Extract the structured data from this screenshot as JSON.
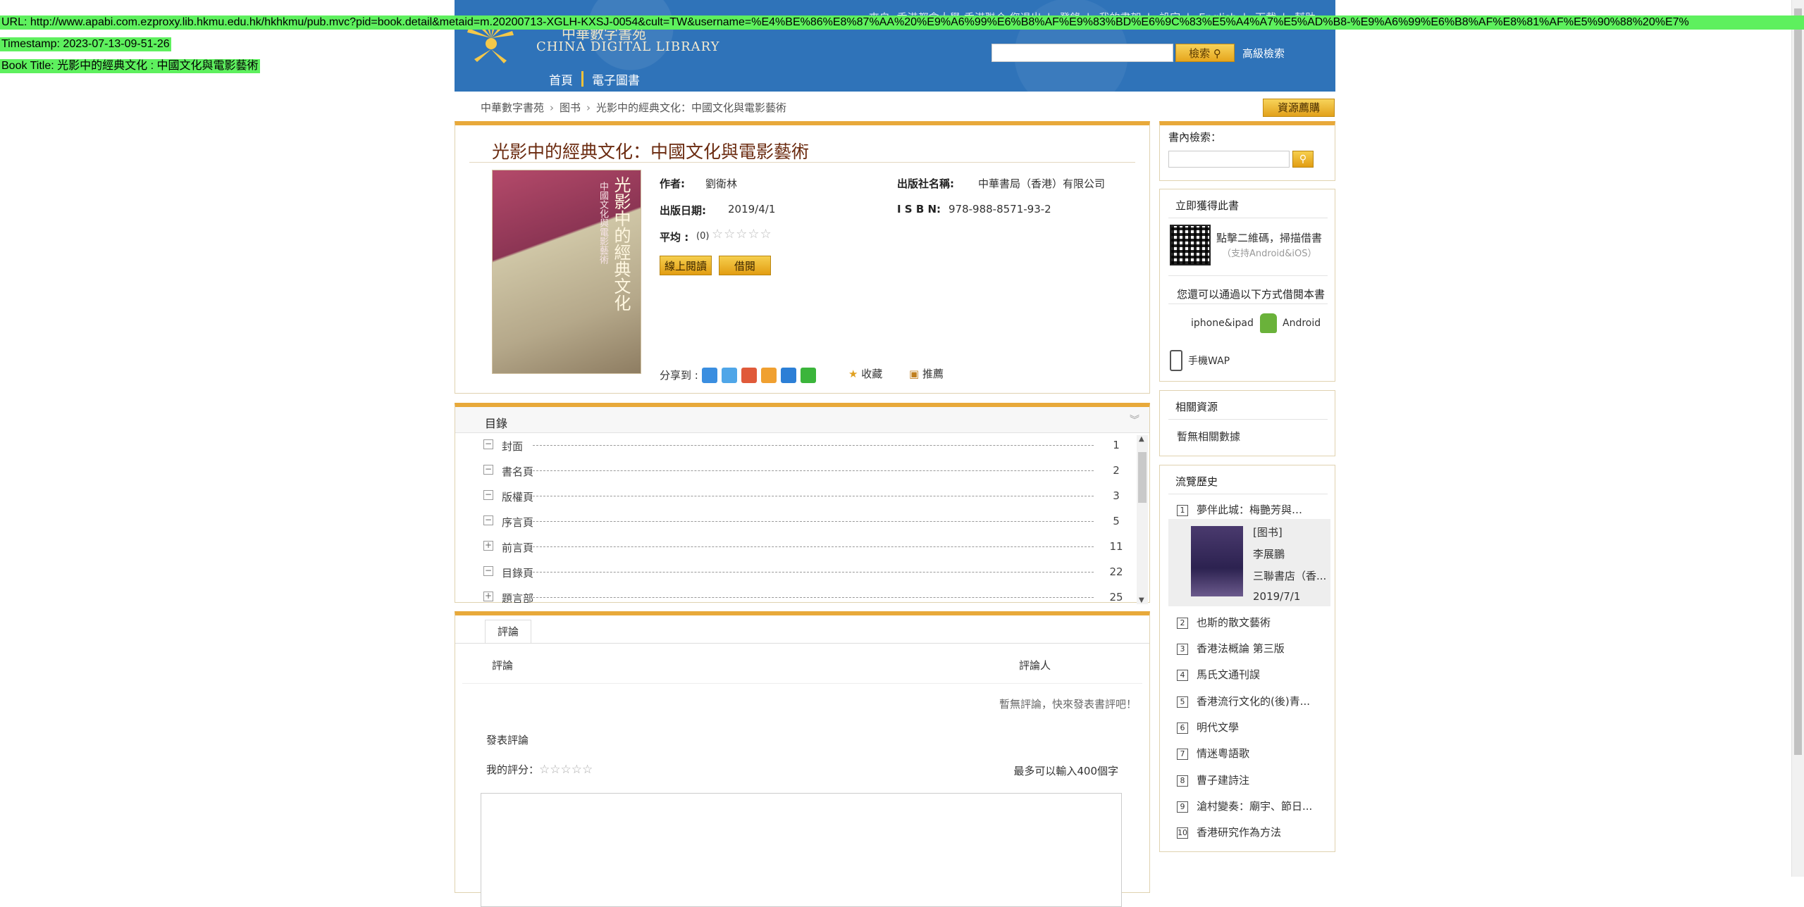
{
  "overlay": {
    "url": "URL: http://www.apabi.com.ezproxy.lib.hkmu.edu.hk/hkhkmu/pub.mvc?pid=book.detail&metaid=m.20200713-XGLH-KXSJ-0054&cult=TW&username=%E4%BE%86%E8%87%AA%20%E9%A6%99%E6%B8%AF%E9%83%BD%E6%9C%83%E5%A4%A7%E5%AD%B8-%E9%A6%99%E6%B8%AF%E8%81%AF%E5%90%88%20%E7%",
    "timestamp": "Timestamp: 2023-07-13-09-51-26",
    "book_title": "Book Title: 光影中的經典文化 : 中國文化與電影藝術"
  },
  "header": {
    "top_links": [
      "來自: 香港都會大學-香港聯合 您退出",
      "登錄",
      "我的書架",
      "設定",
      "English",
      "下載",
      "幫助"
    ],
    "logo_cn": "中華數字書苑",
    "logo_en": "CHINA DIGITAL LIBRARY",
    "search_button": "檢索",
    "advanced_search": "高級檢索",
    "nav": [
      "首頁",
      "電子圖書"
    ]
  },
  "breadcrumb": [
    "中華數字書苑",
    "图书",
    "光影中的經典文化：中國文化與電影藝術"
  ],
  "purchase_button": "資源薦購",
  "book": {
    "title": "光影中的經典文化：中國文化與電影藝術",
    "cover_title": "光影中的經典文化",
    "cover_sub": "中國文化與電影藝術",
    "author_label": "作者:",
    "author": "劉衛林",
    "publisher_label": "出版社名稱:",
    "publisher": "中華書局（香港）有限公司",
    "date_label": "出版日期:",
    "date": "2019/4/1",
    "isbn_label": "I S B N:",
    "isbn": "978-988-8571-93-2",
    "rating_label": "平均 :",
    "rating_count": "(0)",
    "rating_stars": "☆☆☆☆☆",
    "read_online": "線上閱讀",
    "borrow": "借閱",
    "share_label": "分享到 :",
    "favorite": "收藏",
    "recommend": "推薦"
  },
  "toc": {
    "header": "目錄",
    "items": [
      {
        "toggle": "−",
        "name": "封面",
        "page": "1"
      },
      {
        "toggle": "−",
        "name": "書名頁",
        "page": "2"
      },
      {
        "toggle": "−",
        "name": "版權頁",
        "page": "3"
      },
      {
        "toggle": "−",
        "name": "序言頁",
        "page": "5"
      },
      {
        "toggle": "+",
        "name": "前言頁",
        "page": "11"
      },
      {
        "toggle": "−",
        "name": "目錄頁",
        "page": "22"
      },
      {
        "toggle": "+",
        "name": "題言部",
        "page": "25"
      }
    ]
  },
  "comments": {
    "tab": "評論",
    "col_comment": "評論",
    "col_author": "評論人",
    "empty": "暫無評論，快來發表書評吧！",
    "post_title": "發表評論",
    "my_rating": "我的評分：",
    "my_rating_stars": "☆☆☆☆☆",
    "limit": "最多可以輸入400個字"
  },
  "sidebar": {
    "inbook_label": "書內檢索：",
    "get_book_title": "立即獲得此書",
    "qr_text": "點擊二維碼，掃描借書",
    "qr_sub": "（支持Android&iOS）",
    "other_ways": "您還可以通過以下方式借閱本書",
    "iphone": "iphone&ipad",
    "android": "Android",
    "wap": "手機WAP",
    "related_title": "相關資源",
    "related_empty": "暫無相關數據",
    "history_title": "流覽歷史",
    "history": [
      {
        "num": "1",
        "title": "夢伴此城：梅艷芳與…"
      },
      {
        "num": "2",
        "title": "也斯的散文藝術"
      },
      {
        "num": "3",
        "title": "香港法概論 第三版"
      },
      {
        "num": "4",
        "title": "馬氏文通刊誤"
      },
      {
        "num": "5",
        "title": "香港流行文化的(後)青..."
      },
      {
        "num": "6",
        "title": "明代文學"
      },
      {
        "num": "7",
        "title": "情迷粵語歌"
      },
      {
        "num": "8",
        "title": "曹子建詩注"
      },
      {
        "num": "9",
        "title": "滄村變奏：廟宇、節日..."
      },
      {
        "num": "10",
        "title": "香港研究作為方法"
      }
    ],
    "history_detail": {
      "type": "[图书]",
      "author": "李展鵬",
      "publisher": "三聯書店（香...",
      "date": "2019/7/1"
    }
  }
}
